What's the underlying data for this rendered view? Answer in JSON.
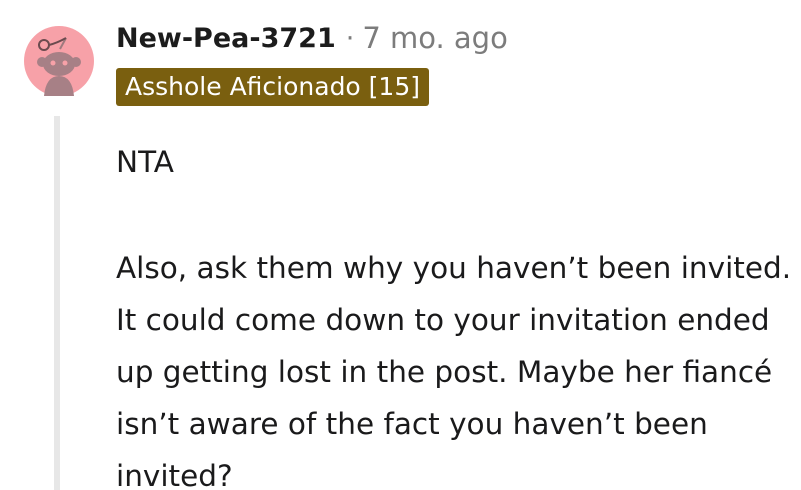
{
  "comment": {
    "username": "New-Pea-3721",
    "separator": "·",
    "timestamp": "7 mo. ago",
    "flair": "Asshole Aficionado [15]",
    "avatar_icon": "reddit-snoo-avatar-icon",
    "paragraphs": [
      "NTA",
      "Also, ask them why you haven’t been invited. It could come down to your invitation ended up getting lost in the post. Maybe her fiancé isn’t aware of the fact you haven’t been invited?"
    ]
  },
  "colors": {
    "avatar_bg": "#f7a1a8",
    "flair_bg": "#7a5f0f",
    "flair_text": "#ffffff",
    "meta_gray": "#7c7c7c",
    "thread_line": "#e7e7e7"
  }
}
